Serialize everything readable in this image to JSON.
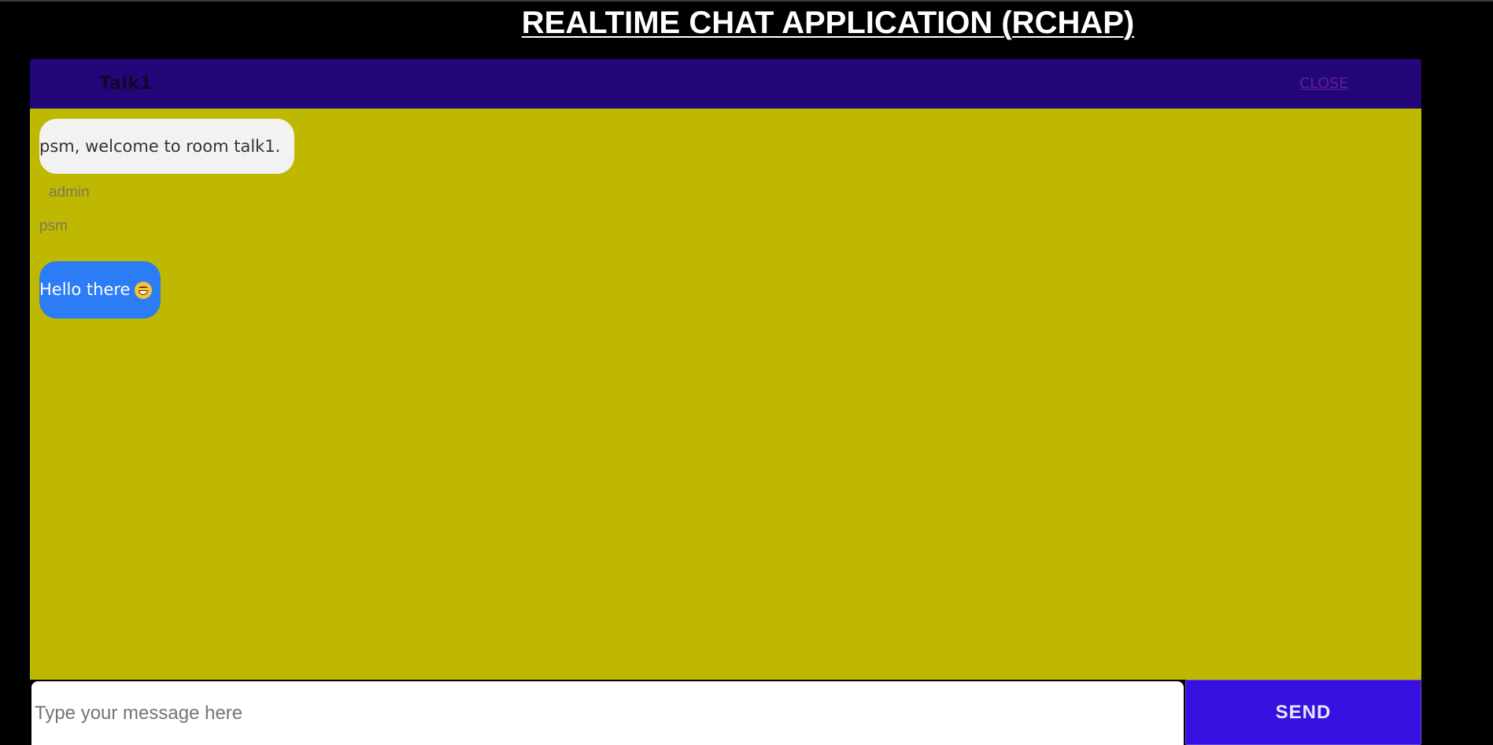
{
  "app": {
    "title": "REALTIME CHAT APPLICATION (RCHAP)"
  },
  "header": {
    "room_name": "Talk1",
    "close_label": "CLOSE"
  },
  "messages": [
    {
      "text": "psm, welcome to room talk1.",
      "sender": "admin",
      "own": false
    },
    {
      "text": "Hello there",
      "sender": "psm",
      "own": true,
      "icon": "grinning-face-emoji"
    }
  ],
  "composer": {
    "value": "",
    "placeholder": "Type your message here",
    "send_label": "SEND"
  },
  "colors": {
    "background": "#000000",
    "header_bg": "#230778",
    "messages_bg": "#bfb800",
    "admin_bubble": "#f2f2f2",
    "user_bubble": "#2b7cf5",
    "send_button": "#3710e2"
  }
}
